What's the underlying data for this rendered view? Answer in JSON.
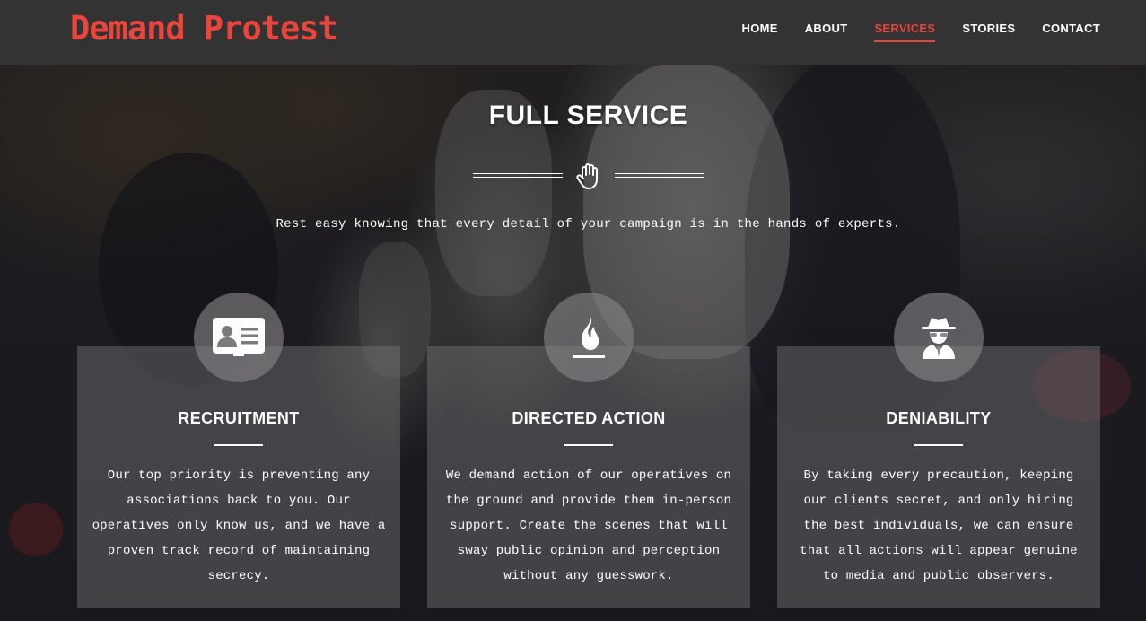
{
  "header": {
    "brand": "Demand Protest",
    "nav": [
      {
        "label": "HOME",
        "active": false
      },
      {
        "label": "ABOUT",
        "active": false
      },
      {
        "label": "SERVICES",
        "active": true
      },
      {
        "label": "STORIES",
        "active": false
      },
      {
        "label": "CONTACT",
        "active": false
      }
    ]
  },
  "section": {
    "title": "FULL SERVICE",
    "divider_icon": "raised-hand-icon",
    "subtitle": "Rest easy knowing that every detail of your campaign is in the hands of experts."
  },
  "services": [
    {
      "icon": "id-card-icon",
      "title": "RECRUITMENT",
      "text": "Our top priority is preventing any associations back to you. Our operatives only know us, and we have a proven track record of maintaining secrecy."
    },
    {
      "icon": "flame-icon",
      "title": "DIRECTED ACTION",
      "text": "We demand action of our operatives on the ground and provide them in-person support. Create the scenes that will sway public opinion and perception without any guesswork."
    },
    {
      "icon": "spy-icon",
      "title": "DENIABILITY",
      "text": "By taking every precaution, keeping our clients secret, and only hiring the best individuals, we can ensure that all actions will appear genuine to media and public observers."
    }
  ],
  "colors": {
    "accent": "#e8453c",
    "navbar": "#333333",
    "text": "#ffffff"
  }
}
